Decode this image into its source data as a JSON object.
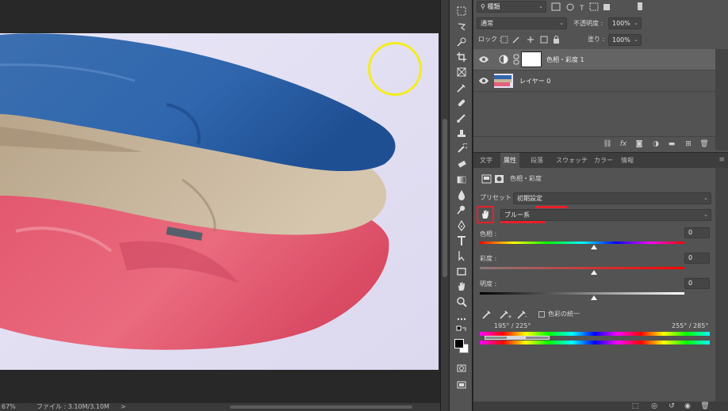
{
  "status": {
    "zoom": "67%",
    "file": "ファイル : 3.10M/3.10M",
    "arrow": ">"
  },
  "layers": {
    "filter_kind": "種類",
    "blend_mode": "通常",
    "opacity_label": "不透明度 :",
    "opacity_value": "100%",
    "lock_label": "ロック :",
    "fill_label": "塗り :",
    "fill_value": "100%",
    "items": [
      {
        "name": "色相・彩度 1"
      },
      {
        "name": "レイヤー 0"
      }
    ]
  },
  "tabs": [
    "文字",
    "属性",
    "段落",
    "スウォッチ",
    "カラー",
    "情報"
  ],
  "properties": {
    "title": "色相・彩度",
    "preset_label": "プリセット :",
    "preset_value": "初期設定",
    "channel_value": "ブルー系",
    "hue_label": "色相 :",
    "hue_value": "0",
    "saturation_label": "彩度 :",
    "saturation_value": "0",
    "lightness_label": "明度 :",
    "lightness_value": "0",
    "colorize_label": "色彩の統一",
    "range_left": "195° / 225°",
    "range_right": "255° / 285°"
  },
  "colors": {
    "accent_red": "#ea1f2b",
    "cursor_yellow": "#f4ec1e",
    "panel": "#535353"
  }
}
